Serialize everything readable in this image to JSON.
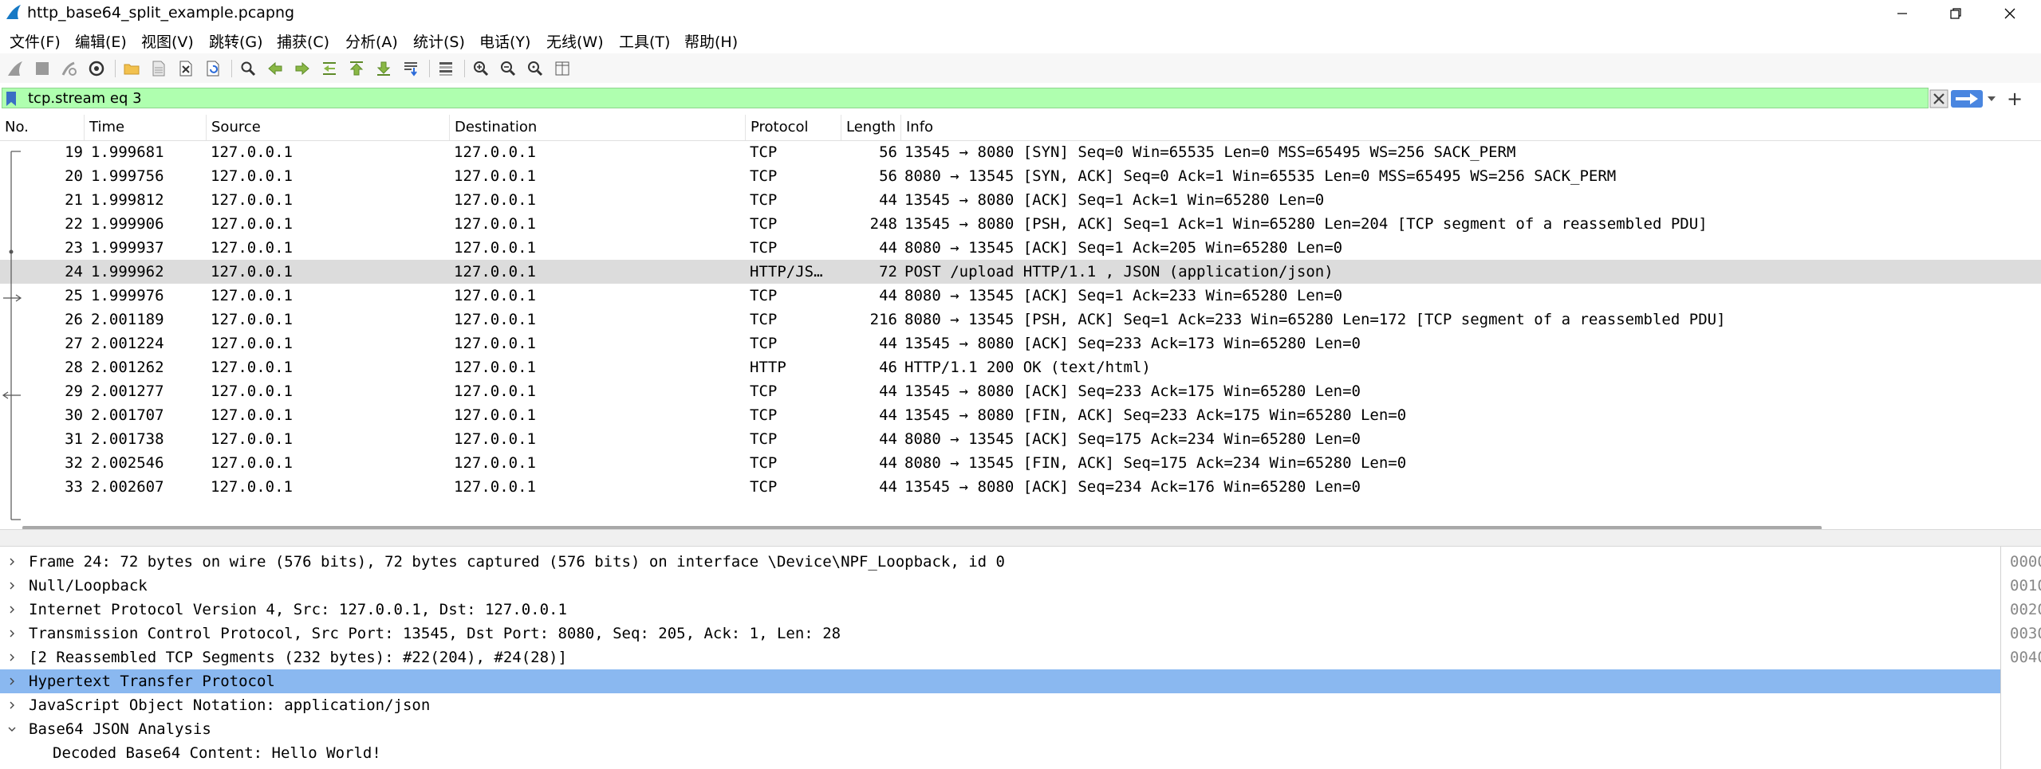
{
  "window": {
    "title": "http_base64_split_example.pcapng"
  },
  "menu": [
    "文件(F)",
    "编辑(E)",
    "视图(V)",
    "跳转(G)",
    "捕获(C)",
    "分析(A)",
    "统计(S)",
    "电话(Y)",
    "无线(W)",
    "工具(T)",
    "帮助(H)"
  ],
  "filter": {
    "value": "tcp.stream eq 3"
  },
  "packet_list": {
    "columns": [
      "No.",
      "Time",
      "Source",
      "Destination",
      "Protocol",
      "Length",
      "Info"
    ],
    "rows": [
      {
        "no": "19",
        "time": "1.999681",
        "src": "127.0.0.1",
        "dst": "127.0.0.1",
        "proto": "TCP",
        "len": "56",
        "info": "13545 → 8080 [SYN] Seq=0 Win=65535 Len=0 MSS=65495 WS=256 SACK_PERM"
      },
      {
        "no": "20",
        "time": "1.999756",
        "src": "127.0.0.1",
        "dst": "127.0.0.1",
        "proto": "TCP",
        "len": "56",
        "info": "8080 → 13545 [SYN, ACK] Seq=0 Ack=1 Win=65535 Len=0 MSS=65495 WS=256 SACK_PERM"
      },
      {
        "no": "21",
        "time": "1.999812",
        "src": "127.0.0.1",
        "dst": "127.0.0.1",
        "proto": "TCP",
        "len": "44",
        "info": "13545 → 8080 [ACK] Seq=1 Ack=1 Win=65280 Len=0"
      },
      {
        "no": "22",
        "time": "1.999906",
        "src": "127.0.0.1",
        "dst": "127.0.0.1",
        "proto": "TCP",
        "len": "248",
        "info": "13545 → 8080 [PSH, ACK] Seq=1 Ack=1 Win=65280 Len=204 [TCP segment of a reassembled PDU]"
      },
      {
        "no": "23",
        "time": "1.999937",
        "src": "127.0.0.1",
        "dst": "127.0.0.1",
        "proto": "TCP",
        "len": "44",
        "info": "8080 → 13545 [ACK] Seq=1 Ack=205 Win=65280 Len=0"
      },
      {
        "no": "24",
        "time": "1.999962",
        "src": "127.0.0.1",
        "dst": "127.0.0.1",
        "proto": "HTTP/JS…",
        "len": "72",
        "info": "POST /upload HTTP/1.1 , JSON (application/json)",
        "selected": true
      },
      {
        "no": "25",
        "time": "1.999976",
        "src": "127.0.0.1",
        "dst": "127.0.0.1",
        "proto": "TCP",
        "len": "44",
        "info": "8080 → 13545 [ACK] Seq=1 Ack=233 Win=65280 Len=0"
      },
      {
        "no": "26",
        "time": "2.001189",
        "src": "127.0.0.1",
        "dst": "127.0.0.1",
        "proto": "TCP",
        "len": "216",
        "info": "8080 → 13545 [PSH, ACK] Seq=1 Ack=233 Win=65280 Len=172 [TCP segment of a reassembled PDU]"
      },
      {
        "no": "27",
        "time": "2.001224",
        "src": "127.0.0.1",
        "dst": "127.0.0.1",
        "proto": "TCP",
        "len": "44",
        "info": "13545 → 8080 [ACK] Seq=233 Ack=173 Win=65280 Len=0"
      },
      {
        "no": "28",
        "time": "2.001262",
        "src": "127.0.0.1",
        "dst": "127.0.0.1",
        "proto": "HTTP",
        "len": "46",
        "info": "HTTP/1.1 200 OK  (text/html)"
      },
      {
        "no": "29",
        "time": "2.001277",
        "src": "127.0.0.1",
        "dst": "127.0.0.1",
        "proto": "TCP",
        "len": "44",
        "info": "13545 → 8080 [ACK] Seq=233 Ack=175 Win=65280 Len=0"
      },
      {
        "no": "30",
        "time": "2.001707",
        "src": "127.0.0.1",
        "dst": "127.0.0.1",
        "proto": "TCP",
        "len": "44",
        "info": "13545 → 8080 [FIN, ACK] Seq=233 Ack=175 Win=65280 Len=0"
      },
      {
        "no": "31",
        "time": "2.001738",
        "src": "127.0.0.1",
        "dst": "127.0.0.1",
        "proto": "TCP",
        "len": "44",
        "info": "8080 → 13545 [ACK] Seq=175 Ack=234 Win=65280 Len=0"
      },
      {
        "no": "32",
        "time": "2.002546",
        "src": "127.0.0.1",
        "dst": "127.0.0.1",
        "proto": "TCP",
        "len": "44",
        "info": "8080 → 13545 [FIN, ACK] Seq=175 Ack=234 Win=65280 Len=0"
      },
      {
        "no": "33",
        "time": "2.002607",
        "src": "127.0.0.1",
        "dst": "127.0.0.1",
        "proto": "TCP",
        "len": "44",
        "info": "13545 → 8080 [ACK] Seq=234 Ack=176 Win=65280 Len=0"
      }
    ]
  },
  "details": [
    {
      "text": "Frame 24: 72 bytes on wire (576 bits), 72 bytes captured (576 bits) on interface \\Device\\NPF_Loopback, id 0",
      "state": "collapsed"
    },
    {
      "text": "Null/Loopback",
      "state": "collapsed"
    },
    {
      "text": "Internet Protocol Version 4, Src: 127.0.0.1, Dst: 127.0.0.1",
      "state": "collapsed"
    },
    {
      "text": "Transmission Control Protocol, Src Port: 13545, Dst Port: 8080, Seq: 205, Ack: 1, Len: 28",
      "state": "collapsed"
    },
    {
      "text": "[2 Reassembled TCP Segments (232 bytes): #22(204), #24(28)]",
      "state": "collapsed"
    },
    {
      "text": "Hypertext Transfer Protocol",
      "state": "collapsed",
      "selected": true
    },
    {
      "text": "JavaScript Object Notation: application/json",
      "state": "collapsed"
    },
    {
      "text": "Base64 JSON Analysis",
      "state": "expanded"
    },
    {
      "text": "Decoded Base64 Content: Hello World!",
      "state": "child"
    }
  ],
  "hex_offsets": [
    "0000",
    "0010",
    "0020",
    "0030",
    "0040"
  ],
  "colors": {
    "filter_bg": "#afffaf",
    "selected_packet": "#dcdcdc",
    "selected_detail": "#8ab8f0"
  }
}
